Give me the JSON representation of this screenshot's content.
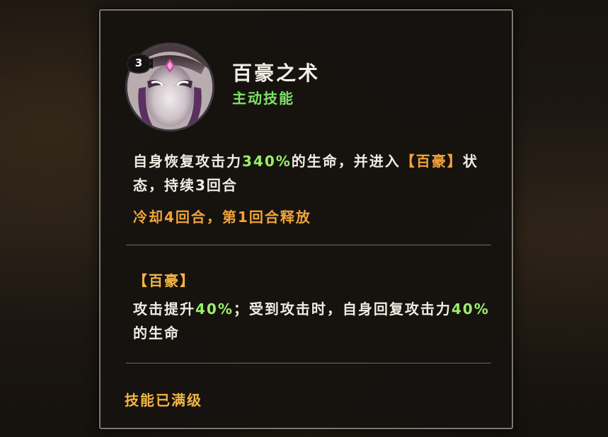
{
  "skill": {
    "level": "3",
    "name": "百豪之术",
    "type": "主动技能",
    "description": {
      "part1": "自身恢复攻击力",
      "value1": "340%",
      "part2": "的生命，并进入",
      "bracket_open": "【",
      "state_name": "百豪",
      "bracket_close": "】",
      "part3": "状态，持续3回合"
    },
    "cooldown": "冷却4回合，第1回合释放"
  },
  "effect": {
    "title": "【百豪】",
    "part1": "攻击提升",
    "value1": "40%",
    "part2": "；受到攻击时，自身回复攻击力",
    "value2": "40%",
    "part3": "的生命"
  },
  "status": {
    "max_level": "技能已满级"
  },
  "colors": {
    "skill_type": "#7fe16a",
    "highlight_value": "#9af06a",
    "cooldown": "#f2a43a",
    "effect_title": "#f4b543"
  },
  "icons": {
    "skill": "bai-hao-seal-icon"
  }
}
